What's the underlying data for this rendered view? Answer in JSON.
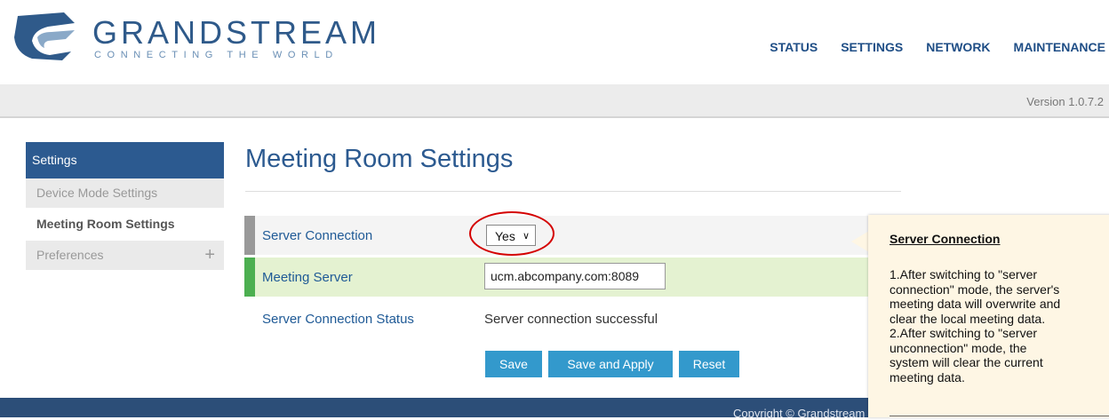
{
  "brand": {
    "name": "GRANDSTREAM",
    "tagline": "CONNECTING THE WORLD"
  },
  "nav": [
    "STATUS",
    "SETTINGS",
    "NETWORK",
    "MAINTENANCE"
  ],
  "version": "Version 1.0.7.2",
  "sidebar": {
    "header": "Settings",
    "items": [
      {
        "label": "Device Mode Settings"
      },
      {
        "label": "Meeting Room Settings"
      },
      {
        "label": "Preferences"
      }
    ]
  },
  "page": {
    "title": "Meeting Room Settings",
    "rows": [
      {
        "label": "Server Connection",
        "value": "Yes"
      },
      {
        "label": "Meeting Server",
        "value": "ucm.abcompany.com:8089"
      },
      {
        "label": "Server Connection Status",
        "value": "Server connection successful"
      }
    ],
    "buttons": {
      "save": "Save",
      "save_apply": "Save and Apply",
      "reset": "Reset"
    }
  },
  "help": {
    "title": "Server Connection",
    "lines": [
      "1.After switching to \"server",
      "connection\" mode, the server's",
      "meeting data will overwrite and",
      "clear the local meeting data.",
      "2.After switching to \"server",
      "unconnection\" mode, the",
      "system will clear the current",
      "meeting data."
    ]
  },
  "footer": "Copyright © Grandstream",
  "colors": {
    "primary": "#2c5a90",
    "button": "#3399cc",
    "highlight_row": "#e4f2d1",
    "marker": "#d40000"
  }
}
